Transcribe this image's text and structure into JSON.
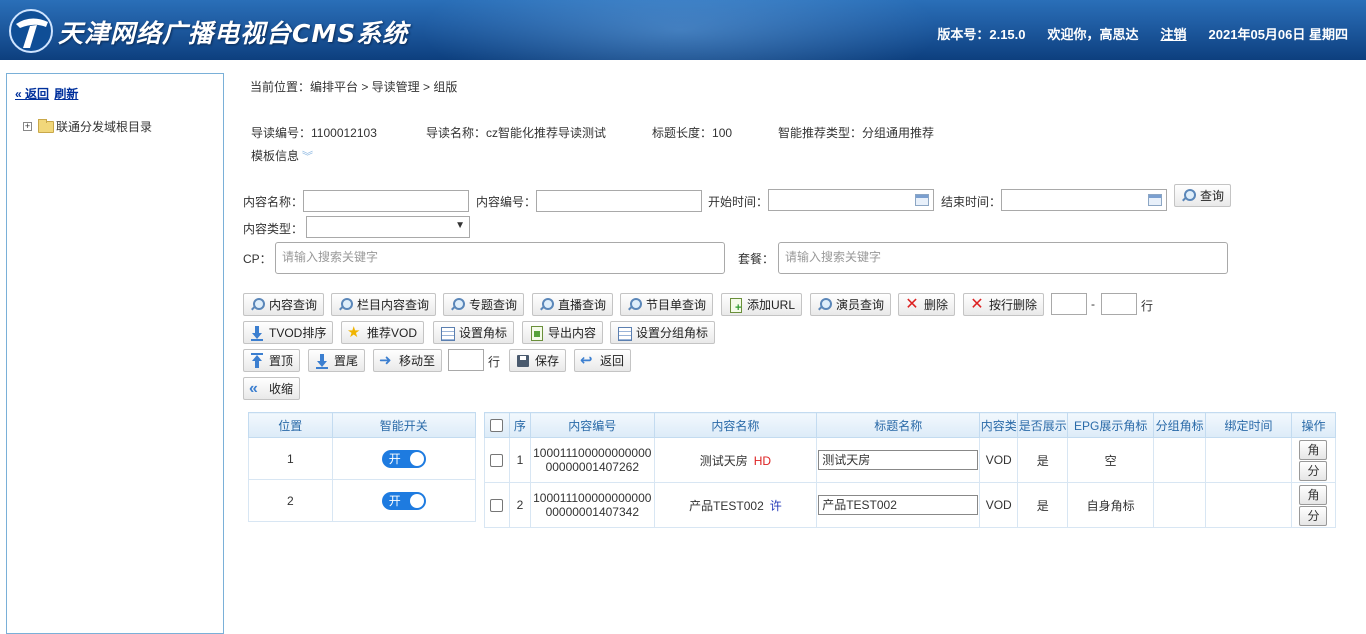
{
  "header": {
    "title": "天津网络广播电视台CMS系统",
    "version": "版本号：2.15.0",
    "welcome": "欢迎你，高思达",
    "logout": "注销",
    "date": "2021年05月06日 星期四"
  },
  "sidebar": {
    "back": "« 返回",
    "refresh": "刷新",
    "tree_root": "联通分发域根目录"
  },
  "breadcrumb": "当前位置：编排平台 > 导读管理 > 组版",
  "info": {
    "id_label": "导读编号：",
    "id_value": "1100012103",
    "name_label": "导读名称：",
    "name_value": "cz智能化推荐导读测试",
    "len_label": "标题长度：",
    "len_value": "100",
    "type_label": "智能推荐类型：",
    "type_value": "分组通用推荐",
    "template": "模板信息"
  },
  "search": {
    "content_name_label": "内容名称：",
    "content_id_label": "内容编号：",
    "start_label": "开始时间：",
    "end_label": "结束时间：",
    "query_btn": "查询",
    "content_type_label": "内容类型：",
    "cp_label": "CP：",
    "cp_placeholder": "请输入搜索关键字",
    "package_label": "套餐：",
    "package_placeholder": "请输入搜索关键字"
  },
  "toolbar": {
    "row1": [
      "内容查询",
      "栏目内容查询",
      "专题查询",
      "直播查询",
      "节目单查询",
      "添加URL",
      "演员查询",
      "删除",
      "按行删除"
    ],
    "dash": "-",
    "row_unit": "行",
    "row2": [
      "TVOD排序",
      "推荐VOD",
      "设置角标",
      "导出内容",
      "设置分组角标"
    ],
    "row3": [
      "置顶",
      "置尾",
      "移动至"
    ],
    "row3_unit": "行",
    "save": "保存",
    "back": "返回",
    "collapse": "收缩"
  },
  "pos_table": {
    "headers": [
      "位置",
      "智能开关"
    ],
    "rows": [
      {
        "pos": "1",
        "switch": "开"
      },
      {
        "pos": "2",
        "switch": "开"
      }
    ]
  },
  "main_table": {
    "headers": [
      "序",
      "内容编号",
      "内容名称",
      "标题名称",
      "内容类",
      "是否展示",
      "EPG展示角标",
      "分组角标",
      "绑定时间",
      "操作"
    ],
    "rows": [
      {
        "seq": "1",
        "id": "10001110000000000000000001407262",
        "name": "测试天房",
        "tag": "HD",
        "title": "测试天房",
        "type": "VOD",
        "show": "是",
        "epg": "空",
        "group": "",
        "bind": "",
        "op1": "角",
        "op2": "分"
      },
      {
        "seq": "2",
        "id": "10001110000000000000000001407342",
        "name": "产品TEST002",
        "tag": "许",
        "title": "产品TEST002",
        "type": "VOD",
        "show": "是",
        "epg": "自身角标",
        "group": "",
        "bind": "",
        "op1": "角",
        "op2": "分"
      }
    ]
  }
}
